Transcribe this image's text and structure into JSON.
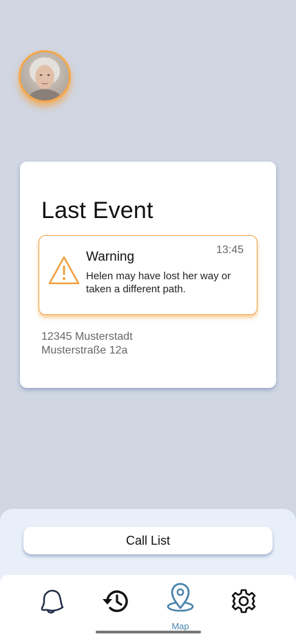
{
  "profile": {
    "avatar_icon": "elderly-woman-portrait",
    "accent_color": "#f3a74a"
  },
  "event_card": {
    "title": "Last Event",
    "warning": {
      "label": "Warning",
      "time": "13:45",
      "message": "Helen may have lost her way or taken a different path.",
      "icon": "warning-triangle-icon",
      "color": "#f0a040"
    },
    "address": {
      "line1": "12345 Musterstadt",
      "line2": "Musterstraße 12a"
    }
  },
  "actions": {
    "call_list_label": "Call List"
  },
  "nav": {
    "items": [
      {
        "icon": "bell-icon",
        "label": ""
      },
      {
        "icon": "history-icon",
        "label": ""
      },
      {
        "icon": "map-pin-icon",
        "label": "Map",
        "active": true
      },
      {
        "icon": "gear-icon",
        "label": ""
      }
    ],
    "active_color": "#4a84ad"
  }
}
